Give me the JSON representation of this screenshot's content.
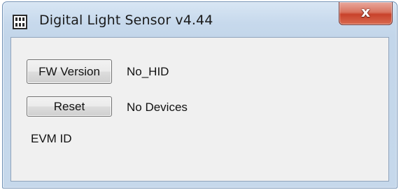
{
  "window": {
    "title": "Digital Light Sensor v4.44",
    "app_icon": "app-window-icon",
    "close_icon": "close-icon",
    "close_glyph": "x"
  },
  "main": {
    "fw_version_button": "FW Version",
    "hid_status": "No_HID",
    "reset_button": "Reset",
    "device_status": "No Devices",
    "evm_id_label": "EVM ID"
  },
  "colors": {
    "titlebar": "#c6d8eb",
    "client_background": "#f0f0f0",
    "close_button": "#c8422b"
  }
}
